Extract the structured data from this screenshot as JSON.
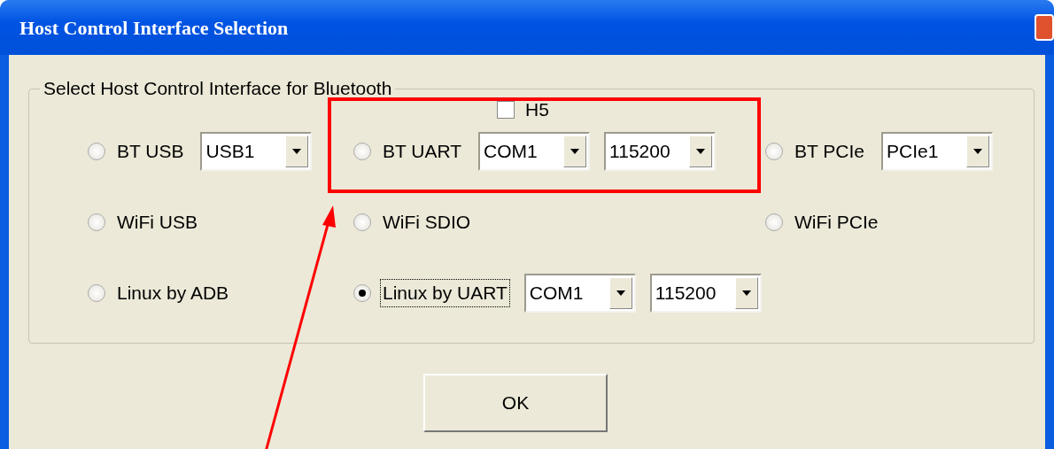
{
  "window": {
    "title": "Host Control Interface Selection"
  },
  "group": {
    "label": "Select Host Control Interface for Bluetooth",
    "options": [
      {
        "label": "BT USB",
        "selected": false,
        "focused": false,
        "dropdowns": [
          {
            "value": "USB1"
          }
        ]
      },
      {
        "label": "BT UART",
        "selected": false,
        "focused": false,
        "checkbox": {
          "label": "H5",
          "checked": false
        },
        "dropdowns": [
          {
            "value": "COM1"
          },
          {
            "value": "115200"
          }
        ]
      },
      {
        "label": "BT PCIe",
        "selected": false,
        "focused": false,
        "dropdowns": [
          {
            "value": "PCIe1"
          }
        ]
      },
      {
        "label": "WiFi USB",
        "selected": false,
        "focused": false
      },
      {
        "label": "WiFi SDIO",
        "selected": false,
        "focused": false
      },
      {
        "label": "WiFi PCIe",
        "selected": false,
        "focused": false
      },
      {
        "label": "Linux by ADB",
        "selected": false,
        "focused": false
      },
      {
        "label": "Linux by UART",
        "selected": true,
        "focused": true,
        "dropdowns": [
          {
            "value": "COM1"
          },
          {
            "value": "115200"
          }
        ]
      }
    ]
  },
  "buttons": [
    {
      "label": "OK"
    }
  ]
}
